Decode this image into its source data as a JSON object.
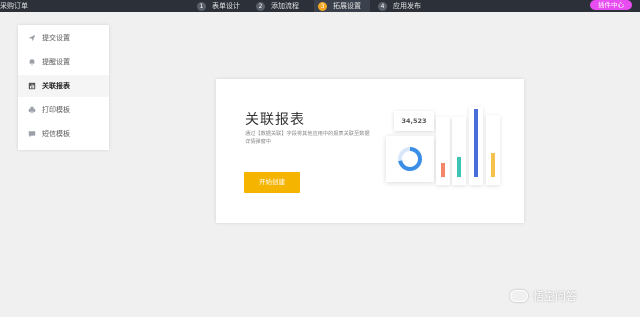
{
  "topbar": {
    "app_title": "采购订单",
    "steps": [
      {
        "num": "1",
        "label": "表单设计"
      },
      {
        "num": "2",
        "label": "添加流程"
      },
      {
        "num": "3",
        "label": "拓展设置"
      },
      {
        "num": "4",
        "label": "应用发布"
      }
    ],
    "plugin_label": "插件中心"
  },
  "sidebar": {
    "items": [
      {
        "label": "提交设置",
        "icon": "send-icon"
      },
      {
        "label": "提醒设置",
        "icon": "bell-icon"
      },
      {
        "label": "关联报表",
        "icon": "report-icon"
      },
      {
        "label": "打印模板",
        "icon": "printer-icon"
      },
      {
        "label": "短信模板",
        "icon": "message-icon"
      }
    ],
    "active_index": 2
  },
  "main": {
    "title": "关联报表",
    "description": "通过【数据关联】字段将其他应用中的报表关联至数据详情弹窗中",
    "start_button": "开始创建",
    "stat_value": "34,523"
  },
  "colors": {
    "topbar": "#2b3039",
    "accent": "#f4b400",
    "plugin": "#e74df0",
    "bar_colors": [
      "#f4876a",
      "#3ec4b5",
      "#4a6fd8",
      "#f5c14d"
    ],
    "donut": "#3a8ee6"
  },
  "watermark": {
    "text": "悟空问答"
  }
}
